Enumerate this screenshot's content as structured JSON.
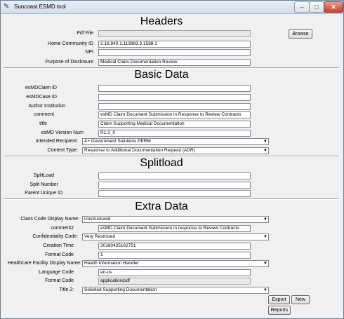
{
  "window": {
    "title": "Suncoast ESMD tool"
  },
  "headers": {
    "title": "Headers",
    "pdf_file_label": "Pdf File",
    "pdf_file_value": "",
    "home_community_label": "Home Community ID",
    "home_community_value": "2.16.840.1.113883.3.1588.1",
    "npi_label": "NPI",
    "npi_value": "",
    "purpose_label": "Purpose of Disclosure",
    "purpose_value": "Medical Claim Documentation Review",
    "browse_label": "Browse"
  },
  "basic": {
    "title": "Basic Data",
    "esmd_claim_label": "esMDClaim ID",
    "esmd_claim_value": "",
    "esmd_case_label": "esMDCase ID",
    "esmd_case_value": "",
    "author_label": "Author Institution",
    "author_value": "",
    "comment_label": "comment",
    "comment_value": "esMD Claim Document Submission in Response to Review Contracto",
    "title_label": "title",
    "title_value": "Claim Supporting Medical Documentation",
    "version_label": "esMD Version Num",
    "version_value": "R1.3_0",
    "recipient_label": "Intended Recipient:",
    "recipient_value": "A+ Government Solutions PERM",
    "content_type_label": "Content Type:",
    "content_type_value": "Response to Additional Documentation Request (ADR)"
  },
  "splitload": {
    "title": "Splitload",
    "splitload_label": "SplitLoad",
    "splitload_value": "",
    "split_number_label": "Split Number",
    "split_number_value": "",
    "parent_label": "Parent Unique ID",
    "parent_value": ""
  },
  "extra": {
    "title": "Extra Data",
    "class_code_label": "Class Code Display Name:",
    "class_code_value": "Unstructured",
    "comment2_label": "comment2",
    "comment2_value": "esMD Claim Document Submission in response to Review Contracto",
    "confidentiality_label": "Confidentiality Code:",
    "confidentiality_value": "Very Restricted",
    "creation_label": "Creation Time",
    "creation_value": "20180425162751",
    "format_code_label": "Format Code",
    "format_code_value": "1",
    "facility_label": "Healthcare Facility Display Name:",
    "facility_value": "Health Information Handler",
    "language_label": "Language Code",
    "language_value": "en-us",
    "format_code2_label": "Format Code",
    "format_code2_value": "application/pdf",
    "title2_label": "Title 2:",
    "title2_value": "Solicited Supporting Documentation"
  },
  "actions": {
    "export_label": "Export",
    "new_label": "New",
    "reports_label": "Reports"
  }
}
